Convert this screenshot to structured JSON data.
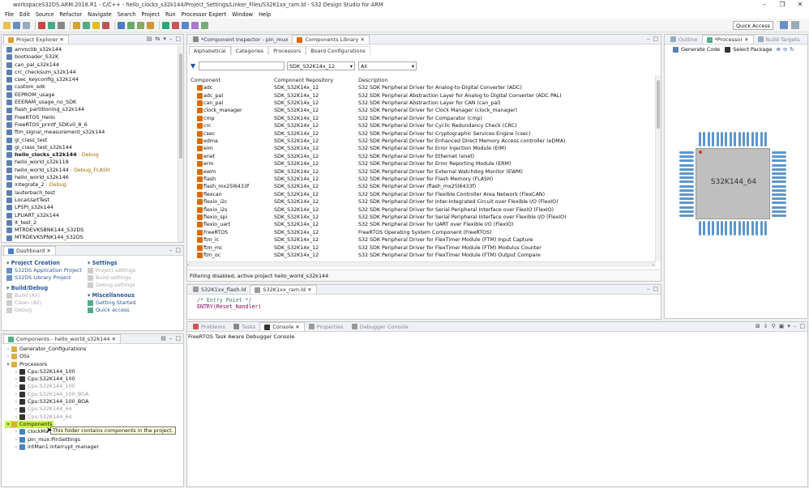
{
  "window": {
    "title": "workspaceS32DS.ARM.2018.R1 - C/C++ - hello_clocks_s32k144/Project_Settings/Linker_Files/S32K1xx_ram.ld - S32 Design Studio for ARM",
    "min": "–",
    "max": "❐",
    "close": "✕"
  },
  "menu": [
    "File",
    "Edit",
    "Source",
    "Refactor",
    "Navigate",
    "Search",
    "Project",
    "Run",
    "Processor Expert",
    "Window",
    "Help"
  ],
  "quick_access": "Quick Access",
  "project_explorer": {
    "tab": "Project Explorer",
    "items": [
      {
        "label": "ammclib_s32k144",
        "deco": ""
      },
      {
        "label": "bootloader_S32K",
        "deco": ""
      },
      {
        "label": "can_pal_s32k144",
        "deco": ""
      },
      {
        "label": "crc_checksum_s32k144",
        "deco": ""
      },
      {
        "label": "csec_keyconfig_s32k144",
        "deco": ""
      },
      {
        "label": "custom_sdk",
        "deco": ""
      },
      {
        "label": "EEPROM_usage",
        "deco": ""
      },
      {
        "label": "EEERAM_usage_no_SDK",
        "deco": ""
      },
      {
        "label": "flash_partitioning_s32k144",
        "deco": ""
      },
      {
        "label": "FreeRTOS_Hello",
        "deco": ""
      },
      {
        "label": "FreeRTOS_printf_SDKv0_8_6",
        "deco": ""
      },
      {
        "label": "ftm_signal_measurement_s32k144",
        "deco": ""
      },
      {
        "label": "gl_class_test",
        "deco": ""
      },
      {
        "label": "gl_class_test_s32k144",
        "deco": ""
      },
      {
        "label": "hello_clocks_s32k144",
        "deco": ": Debug"
      },
      {
        "label": "hello_world_s32k118",
        "deco": ""
      },
      {
        "label": "hello_world_s32k144",
        "deco": ": Debug_FLASH"
      },
      {
        "label": "hello_world_s32k146",
        "deco": ""
      },
      {
        "label": "integrate_2",
        "deco": ": Debug"
      },
      {
        "label": "lauterbach_test",
        "deco": ""
      },
      {
        "label": "LocalUartTest",
        "deco": ""
      },
      {
        "label": "LPSPI_s32k144",
        "deco": ""
      },
      {
        "label": "LPUART_s32k144",
        "deco": ""
      },
      {
        "label": "lt_test_2",
        "deco": ""
      },
      {
        "label": "MTRDEVKSBNK144_S32DS",
        "deco": ""
      },
      {
        "label": "MTRDEVKSPNK144_S32DS",
        "deco": ""
      }
    ]
  },
  "dashboard": {
    "tab": "Dashboard",
    "project_creation": {
      "title": "Project Creation",
      "items": [
        "S32DS Application Project",
        "S32DS Library Project"
      ]
    },
    "settings": {
      "title": "Settings",
      "items": [
        "Project settings",
        "Build settings",
        "Debug settings"
      ]
    },
    "build_debug": {
      "title": "Build/Debug",
      "items": [
        "Build  (All)",
        "Clean  (All)",
        "Debug"
      ]
    },
    "misc": {
      "title": "Miscellaneous",
      "items": [
        "Getting Started",
        "Quick access"
      ]
    }
  },
  "components_panel": {
    "tab": "Components - hello_world_s32k144",
    "tree": [
      {
        "label": "Generator_Configurations",
        "level": 0
      },
      {
        "label": "OSs",
        "level": 0
      },
      {
        "label": "Processors",
        "level": 0
      },
      {
        "label": "Cpu:S32K144_100",
        "level": 1
      },
      {
        "label": "Cpu:S32K144_100",
        "level": 1
      },
      {
        "label": "Cpu:S32K144_100",
        "level": 1
      },
      {
        "label": "Cpu:S32K144_100_BGA",
        "level": 1
      },
      {
        "label": "Cpu:S32K144_100_BGA",
        "level": 1
      },
      {
        "label": "Cpu:S32K144_64",
        "level": 1
      },
      {
        "label": "Cpu:S32K144_64",
        "level": 1
      },
      {
        "label": "Components",
        "level": 0
      },
      {
        "label": "clockMa",
        "level": 1
      },
      {
        "label": "pin_mux:PinSettings",
        "level": 1
      },
      {
        "label": "intMan1:interrupt_manager",
        "level": 1
      }
    ],
    "tooltip": "This folder contains components in the project."
  },
  "library": {
    "tabs": [
      "*Component Inspector - pin_mux",
      "Components Library"
    ],
    "subtabs": [
      "Alphabetical",
      "Categories",
      "Processors",
      "Board Configurations"
    ],
    "sdk_select": "SDK_S32K14x_12",
    "filter_select": "All",
    "columns": [
      "Component",
      "Component Repository",
      "Description"
    ],
    "rows": [
      [
        "adc",
        "SDK_S32K14x_12",
        "S32 SDK Peripheral Driver for Analog-to-Digital Converter (ADC)"
      ],
      [
        "adc_pal",
        "SDK_S32K14x_12",
        "S32 SDK Peripheral Abstraction Layer for Analog to Digital Converter (ADC PAL)"
      ],
      [
        "can_pal",
        "SDK_S32K14x_12",
        "S32 SDK Peripheral Abstraction Layer for CAN (can_pal)"
      ],
      [
        "clock_manager",
        "SDK_S32K14x_12",
        "S32 SDK Peripheral Driver for Clock Manager (clock_manager)"
      ],
      [
        "cmp",
        "SDK_S32K14x_12",
        "S32 SDK Peripheral Driver for Comparator (cmp)"
      ],
      [
        "crc",
        "SDK_S32K14x_12",
        "S32 SDK Peripheral Driver for Cyclic Redundancy Check (CRC)"
      ],
      [
        "csec",
        "SDK_S32K14x_12",
        "S32 SDK Peripheral Driver for Cryptographic Services Engine (csec)"
      ],
      [
        "edma",
        "SDK_S32K14x_12",
        "S32 SDK Peripheral Driver for Enhanced Direct Memory Access controller (eDMA)"
      ],
      [
        "eim",
        "SDK_S32K14x_12",
        "S32 SDK Peripheral Driver for Error Injection Module (EIM)"
      ],
      [
        "enet",
        "SDK_S32K14x_12",
        "S32 SDK Peripheral Driver for Ethernet (enet)"
      ],
      [
        "erm",
        "SDK_S32K14x_12",
        "S32 SDK Peripheral Driver for Error Reporting Module (ERM)"
      ],
      [
        "ewm",
        "SDK_S32K14x_12",
        "S32 SDK Peripheral Driver for External Watchdog Monitor (EWM)"
      ],
      [
        "flash",
        "SDK_S32K14x_12",
        "S32 SDK Peripheral Driver for Flash Memory (FLASH)"
      ],
      [
        "flash_mx25l6433f",
        "SDK_S32K14x_12",
        "S32 SDK Peripheral Driver (flash_mx25l6433f)"
      ],
      [
        "flexcan",
        "SDK_S32K14x_12",
        "S32 SDK Peripheral Driver for Flexible Controller Area Network (FlexCAN)"
      ],
      [
        "flexio_i2c",
        "SDK_S32K14x_12",
        "S32 SDK Peripheral Driver for Inter-Integrated Circuit over Flexible I/O (FlexIO)"
      ],
      [
        "flexio_i2s",
        "SDK_S32K14x_12",
        "S32 SDK Peripheral Driver for Serial Peripheral Interface over FlexIO (FlexIO)"
      ],
      [
        "flexio_spi",
        "SDK_S32K14x_12",
        "S32 SDK Peripheral Driver for Serial Peripheral Interface over Flexible I/O (FlexIO)"
      ],
      [
        "flexio_uart",
        "SDK_S32K14x_12",
        "S32 SDK Peripheral Driver for UART over Flexible I/O (FlexIO)"
      ],
      [
        "FreeRTOS",
        "SDK_S32K14x_12",
        "FreeRTOS Operating System Component (FreeRTOS)"
      ],
      [
        "ftm_ic",
        "SDK_S32K14x_12",
        "S32 SDK Peripheral Driver for FlexTimer Module (FTM) Input Capture"
      ],
      [
        "ftm_mc",
        "SDK_S32K14x_12",
        "S32 SDK Peripheral Driver for FlexTimer Module (FTM) Modulus Counter"
      ],
      [
        "ftm_oc",
        "SDK_S32K14x_12",
        "S32 SDK Peripheral Driver for FlexTimer Module (FTM) Output Compare"
      ]
    ],
    "status": "Filtering disabled, active project hello_world_s32k144"
  },
  "editor": {
    "tabs": [
      "S32K1xx_flash.ld",
      "S32K1xx_ram.ld"
    ],
    "lines": [
      {
        "text": "/* Entry Point */",
        "kind": "comment"
      },
      {
        "text": "ENTRY(Reset_Handler)",
        "kind": "kw"
      }
    ]
  },
  "console": {
    "tabs": [
      "Problems",
      "Tasks",
      "Console",
      "Properties",
      "Debugger Console"
    ],
    "content": "FreeRTOS Task Aware Debugger Console"
  },
  "processor": {
    "tabs": [
      "Outline",
      "*Processor",
      "Build Targets"
    ],
    "actions": [
      "Generate Code",
      "Select Package"
    ],
    "chip_label": "S32K144_64"
  },
  "colors": {
    "accent": "#2a5599",
    "chip": "#bfbfbf",
    "pin": "#5e96cc",
    "selected": "#c9f24a"
  }
}
